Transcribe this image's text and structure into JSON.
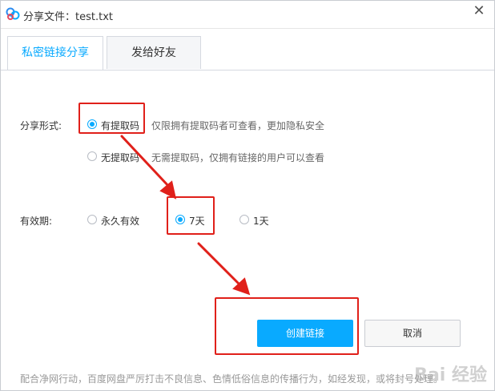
{
  "window": {
    "title": "分享文件：test.txt",
    "close_glyph": "✕",
    "brand_color": "#09aaff",
    "logo_icon": "baidu-netdisk-logo-icon"
  },
  "tabs": [
    {
      "label": "私密链接分享",
      "active": true
    },
    {
      "label": "发给好友",
      "active": false
    }
  ],
  "share_form": {
    "label": "分享形式:",
    "options": [
      {
        "label": "有提取码",
        "checked": true,
        "desc": "仅限拥有提取码者可查看，更加隐私安全"
      },
      {
        "label": "无提取码",
        "checked": false,
        "desc": "无需提取码，仅拥有链接的用户可以查看"
      }
    ]
  },
  "validity": {
    "label": "有效期:",
    "options": [
      {
        "label": "永久有效",
        "checked": false
      },
      {
        "label": "7天",
        "checked": true
      },
      {
        "label": "1天",
        "checked": false
      }
    ]
  },
  "actions": {
    "create_label": "创建链接",
    "cancel_label": "取消"
  },
  "notice": "配合净网行动，百度网盘严厉打击不良信息、色情低俗信息的传播行为，如经发现，或将封号处理。",
  "watermark": "Bai 经验",
  "annotation": {
    "color": "#e0201a"
  }
}
